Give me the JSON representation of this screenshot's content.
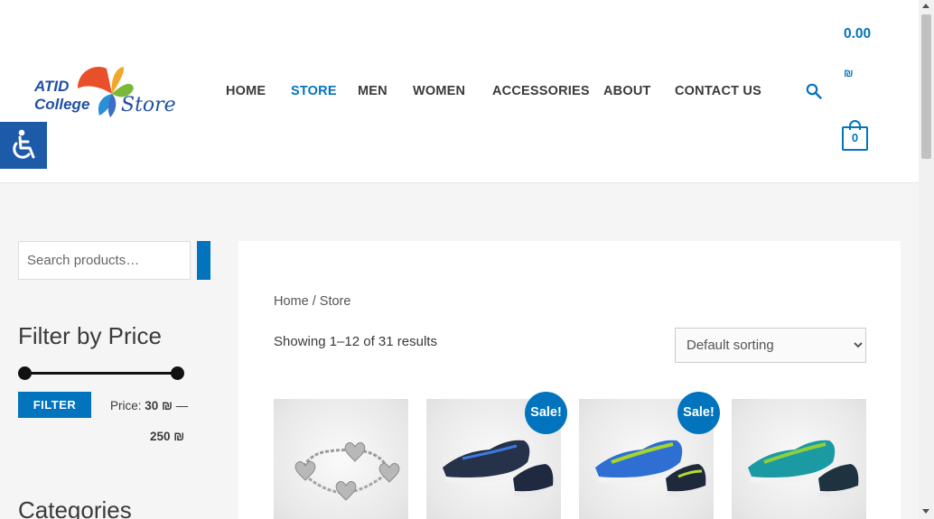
{
  "brand": {
    "logo_line1": "ATID",
    "logo_line2": "College",
    "logo_line3": "Store",
    "accent_color": "#0274be"
  },
  "nav": {
    "items": [
      {
        "label": "HOME",
        "active": false
      },
      {
        "label": "STORE",
        "active": true
      },
      {
        "label": "MEN",
        "active": false
      },
      {
        "label": "WOMEN",
        "active": false
      },
      {
        "label": "ACCESSORIES",
        "active": false
      },
      {
        "label": "ABOUT",
        "active": false
      },
      {
        "label": "CONTACT US",
        "active": false
      }
    ]
  },
  "cart": {
    "total": "0.00",
    "currency": "₪",
    "count": "0"
  },
  "sidebar": {
    "search_placeholder": "Search products…",
    "filter_title": "Filter by Price",
    "filter_button": "FILTER",
    "price_prefix": "Price: ",
    "price_min": "30 ₪",
    "price_sep": " —",
    "price_max": "250 ₪",
    "categories_title": "Categories"
  },
  "main": {
    "breadcrumb_home": "Home",
    "breadcrumb_sep": " / ",
    "breadcrumb_current": "Store",
    "result_count": "Showing 1–12 of 31 results",
    "sort_options": [
      "Default sorting"
    ],
    "sort_selected": "Default sorting"
  },
  "products": [
    {
      "image": "silver-heart-bracelet",
      "sale": false
    },
    {
      "image": "navy-sneakers",
      "sale": true,
      "sale_label": "Sale!"
    },
    {
      "image": "blue-green-sneakers",
      "sale": true,
      "sale_label": "Sale!"
    },
    {
      "image": "teal-sneakers",
      "sale": false
    }
  ]
}
